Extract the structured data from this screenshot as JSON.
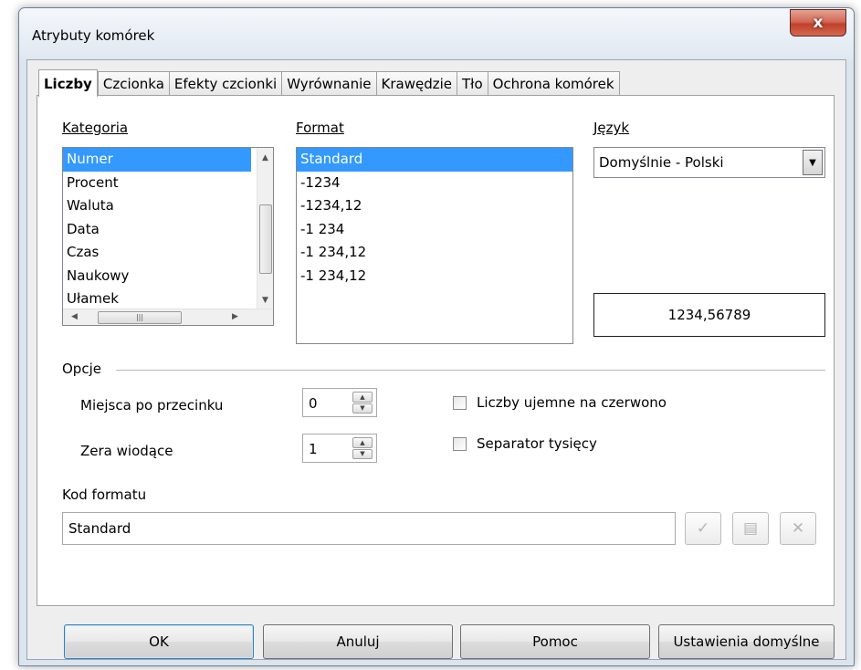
{
  "window": {
    "title": "Atrybuty komórek",
    "close_glyph": "x"
  },
  "tabs": [
    {
      "label": "Liczby",
      "active": true
    },
    {
      "label": "Czcionka"
    },
    {
      "label": "Efekty czcionki"
    },
    {
      "label": "Wyrównanie"
    },
    {
      "label": "Krawędzie"
    },
    {
      "label": "Tło"
    },
    {
      "label": "Ochrona komórek"
    }
  ],
  "category": {
    "label": "Kategoria",
    "items": [
      "Numer",
      "Procent",
      "Waluta",
      "Data",
      "Czas",
      "Naukowy",
      "Ułamek"
    ],
    "selected": "Numer"
  },
  "format": {
    "label": "Format",
    "items": [
      "Standard",
      "-1234",
      "-1234,12",
      "-1 234",
      "-1 234,12",
      "-1 234,12"
    ],
    "selected": "Standard"
  },
  "language": {
    "label": "Język",
    "value": "Domyślnie - Polski"
  },
  "preview": {
    "value": "1234,56789"
  },
  "options": {
    "label": "Opcje",
    "decimal_places": {
      "label": "Miejsca po przecinku",
      "value": "0"
    },
    "leading_zeros": {
      "label": "Zera wiodące",
      "value": "1"
    },
    "negative_red": {
      "label": "Liczby ujemne na czerwono",
      "checked": false
    },
    "thousands_sep": {
      "label": "Separator tysięcy",
      "checked": false
    }
  },
  "format_code": {
    "label": "Kod formatu",
    "value": "Standard"
  },
  "buttons": {
    "ok": "OK",
    "cancel": "Anuluj",
    "help": "Pomoc",
    "reset": "Ustawienia domyślne"
  },
  "icons": {
    "accept": "check-icon",
    "comment": "comment-icon",
    "delete": "delete-icon"
  }
}
